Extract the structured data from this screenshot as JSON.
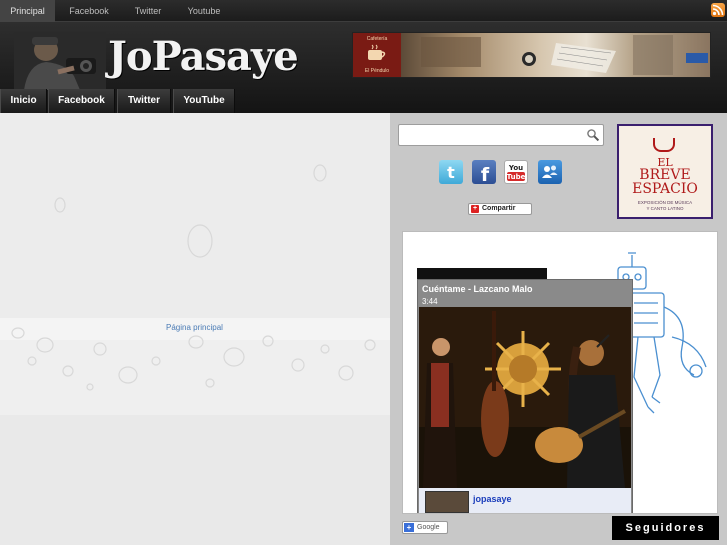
{
  "topbar": {
    "links": [
      "Principal",
      "Facebook",
      "Twitter",
      "Youtube"
    ],
    "active_index": 0,
    "rss_icon": "rss-icon"
  },
  "header": {
    "logo_text": "JoPasaye",
    "banner_text": [
      "Cafetería",
      "El Péndulo"
    ]
  },
  "nav": {
    "items": [
      "Inicio",
      "Facebook",
      "Twitter",
      "YouTube"
    ]
  },
  "main": {
    "home_link": "Página principal"
  },
  "sidebar": {
    "search_placeholder": "",
    "social_icons": [
      "twitter-icon",
      "facebook-icon",
      "youtube-icon",
      "messenger-icon"
    ],
    "share_label": "Compartir",
    "ad": {
      "line1": "EL",
      "line2": "BREVE",
      "line3": "ESPACIO",
      "subtitle1": "EXPOSICIÓN DE MÚSICA",
      "subtitle2": "Y CANTO LATINO"
    },
    "video": {
      "title": "Cuéntame - Lazcano Malo",
      "duration": "3:44",
      "channel": "jopasaye"
    },
    "google_button": "Google",
    "followers_title": "Seguidores"
  },
  "colors": {
    "topbar_bg": "#1e1e1e",
    "accent_link": "#4a7bb5",
    "ad_red": "#b01a1a",
    "channel_blue": "#1a3dbb"
  }
}
